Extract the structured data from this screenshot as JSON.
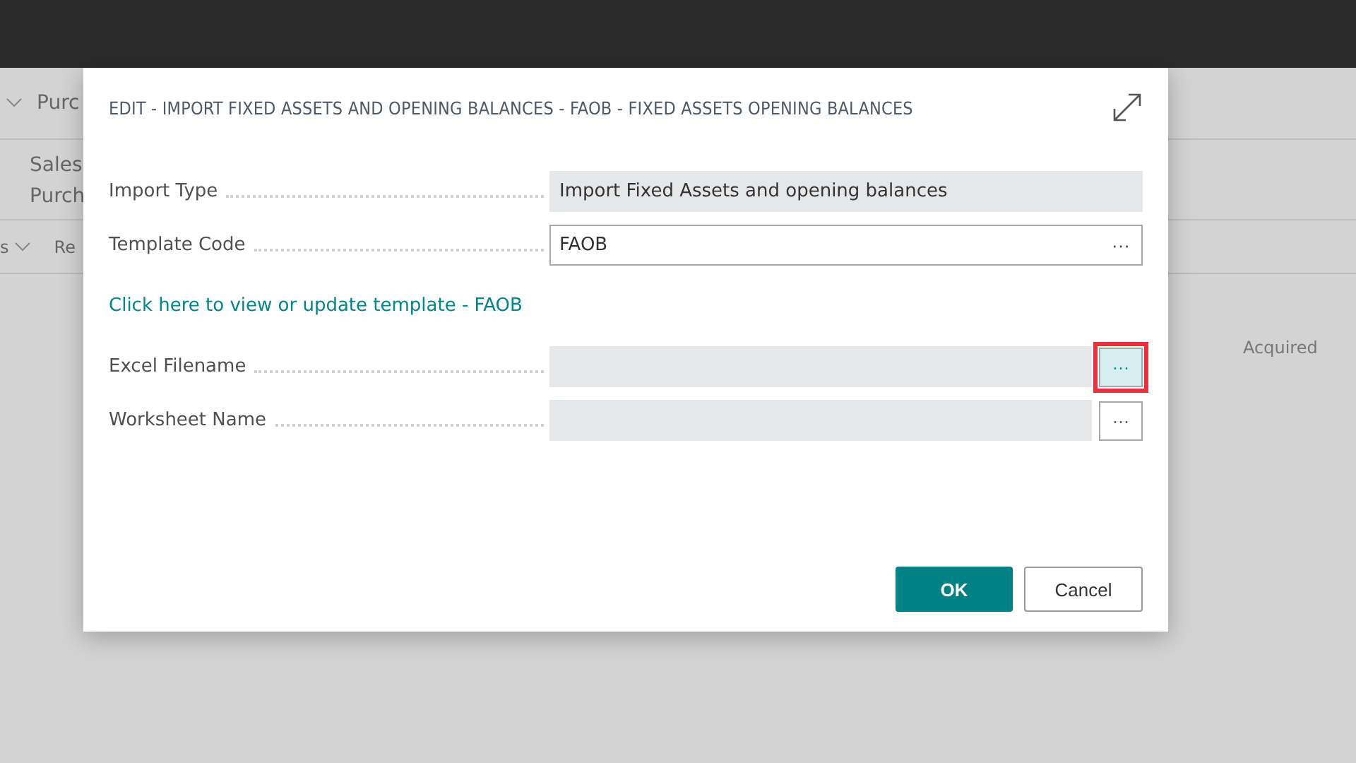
{
  "background": {
    "nav_item": "Purc",
    "actions": [
      "Sales",
      "Purch"
    ],
    "tabs": [
      "s",
      "Re"
    ],
    "column_header": "Acquired"
  },
  "dialog": {
    "title": "EDIT - IMPORT FIXED ASSETS AND OPENING BALANCES - FAOB - FIXED ASSETS OPENING BALANCES",
    "fields": [
      {
        "kind": "readonly",
        "label": "Import Type",
        "value": "Import Fixed Assets and opening balances"
      },
      {
        "kind": "lookup",
        "label": "Template Code",
        "value": "FAOB",
        "button": "···"
      },
      {
        "kind": "link",
        "text": "Click here to view or update template - FAOB"
      },
      {
        "kind": "file",
        "label": "Excel Filename",
        "button": "···",
        "highlighted": true
      },
      {
        "kind": "file",
        "label": "Worksheet Name",
        "button": "···",
        "highlighted": false
      }
    ],
    "buttons": [
      {
        "label": "OK",
        "primary": true
      },
      {
        "label": "Cancel",
        "primary": false
      }
    ]
  }
}
